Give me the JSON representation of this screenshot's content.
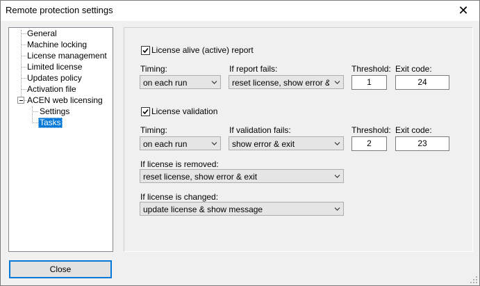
{
  "window": {
    "title": "Remote protection settings"
  },
  "tree": {
    "items": [
      {
        "label": "General"
      },
      {
        "label": "Machine locking"
      },
      {
        "label": "License management"
      },
      {
        "label": "Limited license"
      },
      {
        "label": "Updates policy"
      },
      {
        "label": "Activation file"
      },
      {
        "label": "ACEN web licensing"
      },
      {
        "label": "Settings"
      },
      {
        "label": "Tasks",
        "selected": true
      }
    ]
  },
  "alive": {
    "checkbox_label": "License alive (active) report",
    "checked": true,
    "timing_label": "Timing:",
    "timing_value": "on each run",
    "fails_label": "If report fails:",
    "fails_value": "reset license, show error & exit",
    "threshold_label": "Threshold:",
    "threshold_value": "1",
    "exit_label": "Exit code:",
    "exit_value": "24"
  },
  "validation": {
    "checkbox_label": "License validation",
    "checked": true,
    "timing_label": "Timing:",
    "timing_value": "on each run",
    "fails_label": "If validation fails:",
    "fails_value": "show error & exit",
    "threshold_label": "Threshold:",
    "threshold_value": "2",
    "exit_label": "Exit code:",
    "exit_value": "23"
  },
  "removed": {
    "label": "If license is removed:",
    "value": "reset license, show error & exit"
  },
  "changed": {
    "label": "If license is changed:",
    "value": "update license & show message"
  },
  "buttons": {
    "close_label": "Close"
  }
}
